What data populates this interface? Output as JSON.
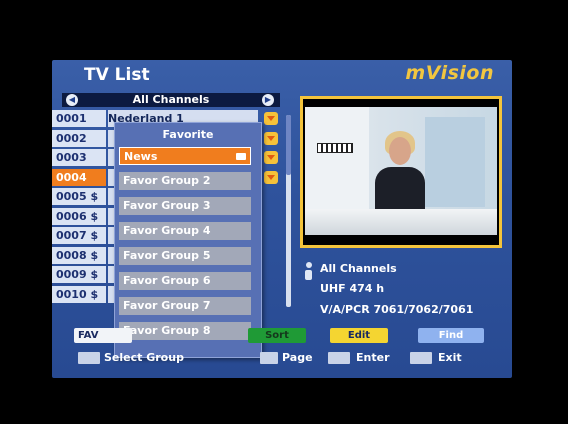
{
  "header": {
    "title": "TV List",
    "brand": "mVision"
  },
  "group_selector": {
    "label": "All Channels"
  },
  "channels": [
    {
      "num": "0001",
      "name": "Nederland 1",
      "fav": true,
      "active": false
    },
    {
      "num": "0002",
      "name": "",
      "fav": true,
      "active": false
    },
    {
      "num": "0003",
      "name": "",
      "fav": true,
      "active": false
    },
    {
      "num": "0004",
      "name": "",
      "fav": true,
      "active": true
    },
    {
      "num": "0005 $",
      "name": "",
      "fav": false,
      "active": false
    },
    {
      "num": "0006 $",
      "name": "",
      "fav": false,
      "active": false
    },
    {
      "num": "0007 $",
      "name": "",
      "fav": false,
      "active": false
    },
    {
      "num": "0008 $",
      "name": "",
      "fav": false,
      "active": false
    },
    {
      "num": "0009 $",
      "name": "",
      "fav": false,
      "active": false
    },
    {
      "num": "0010 $",
      "name": "",
      "fav": false,
      "active": false
    }
  ],
  "favorite_popup": {
    "title": "Favorite",
    "items": [
      "News",
      "Favor Group 2",
      "Favor Group 3",
      "Favor Group 4",
      "Favor Group 5",
      "Favor Group 6",
      "Favor Group 7",
      "Favor Group 8"
    ],
    "selected_index": 0
  },
  "channel_info": {
    "group": "All Channels",
    "frequency": "UHF 474 h",
    "pids": "V/A/PCR 7061/7062/7061"
  },
  "color_buttons": {
    "red": "FAV",
    "green": "Sort",
    "yellow": "Edit",
    "blue": "Find"
  },
  "hints": {
    "select_group": "Select Group",
    "page": "Page",
    "enter": "Enter",
    "exit": "Exit"
  },
  "colors": {
    "panel": "#2f539d",
    "accent_orange": "#f07d1e",
    "brand_yellow": "#f2c640",
    "preview_border": "#f4c43b"
  }
}
